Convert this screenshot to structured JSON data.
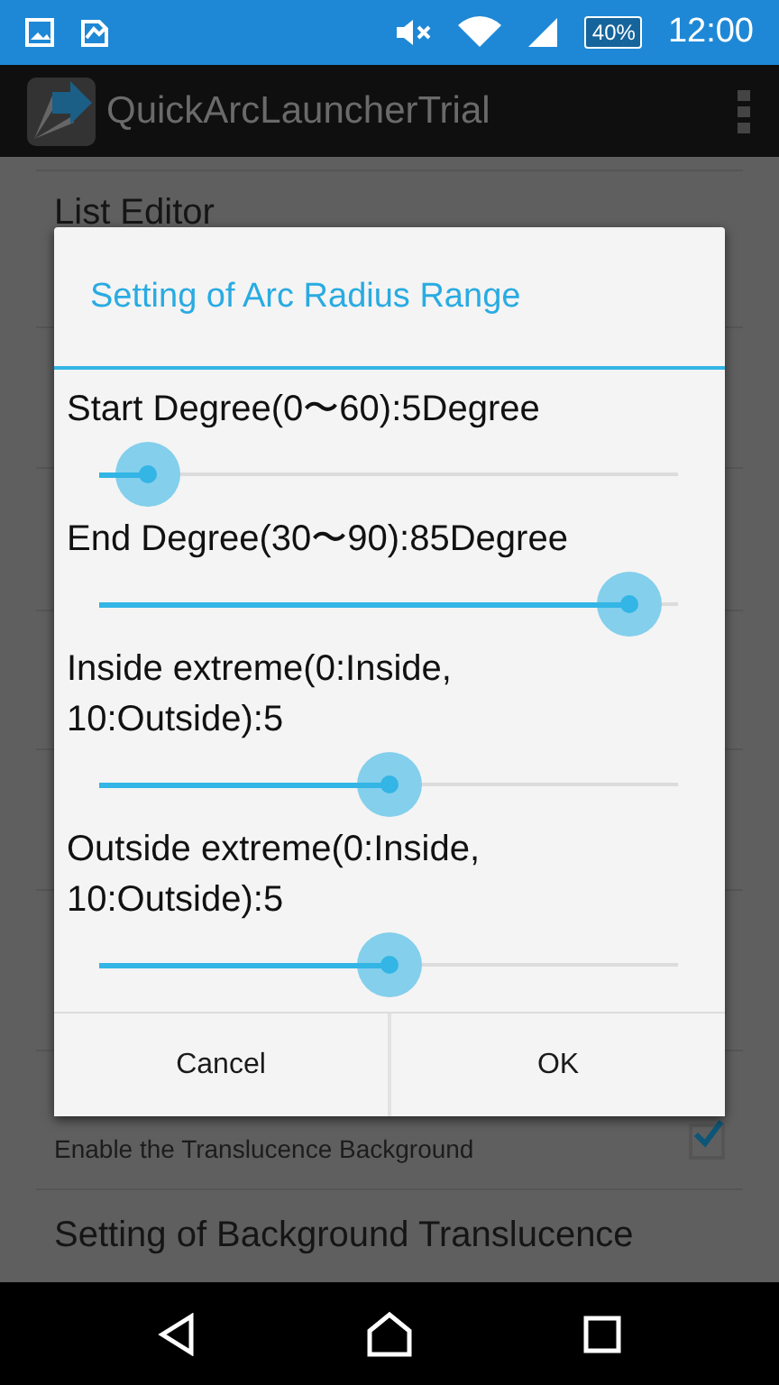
{
  "status_bar": {
    "battery": "40%",
    "time": "12:00"
  },
  "app_bar": {
    "title": "QuickArcLauncherTrial"
  },
  "settings": [
    {
      "kind": "title",
      "title": "List Editor"
    },
    {
      "kind": "checkbox",
      "summary": "Enable the Translucence Background",
      "checked": true
    },
    {
      "kind": "title",
      "title": "Setting of Background Translucence"
    }
  ],
  "dialog": {
    "title": "Setting of Arc Radius Range",
    "sliders": [
      {
        "label": "Start Degree(0〜60):5Degree",
        "level": 0.083
      },
      {
        "label": "End Degree(30〜90):85Degree",
        "level": 0.917
      },
      {
        "label": "Inside extreme(0:Inside, 10:Outside):5",
        "level": 0.5
      },
      {
        "label": "Outside extreme(0:Inside, 10:Outside):5",
        "level": 0.5
      }
    ],
    "buttons": [
      "Cancel",
      "OK"
    ]
  }
}
